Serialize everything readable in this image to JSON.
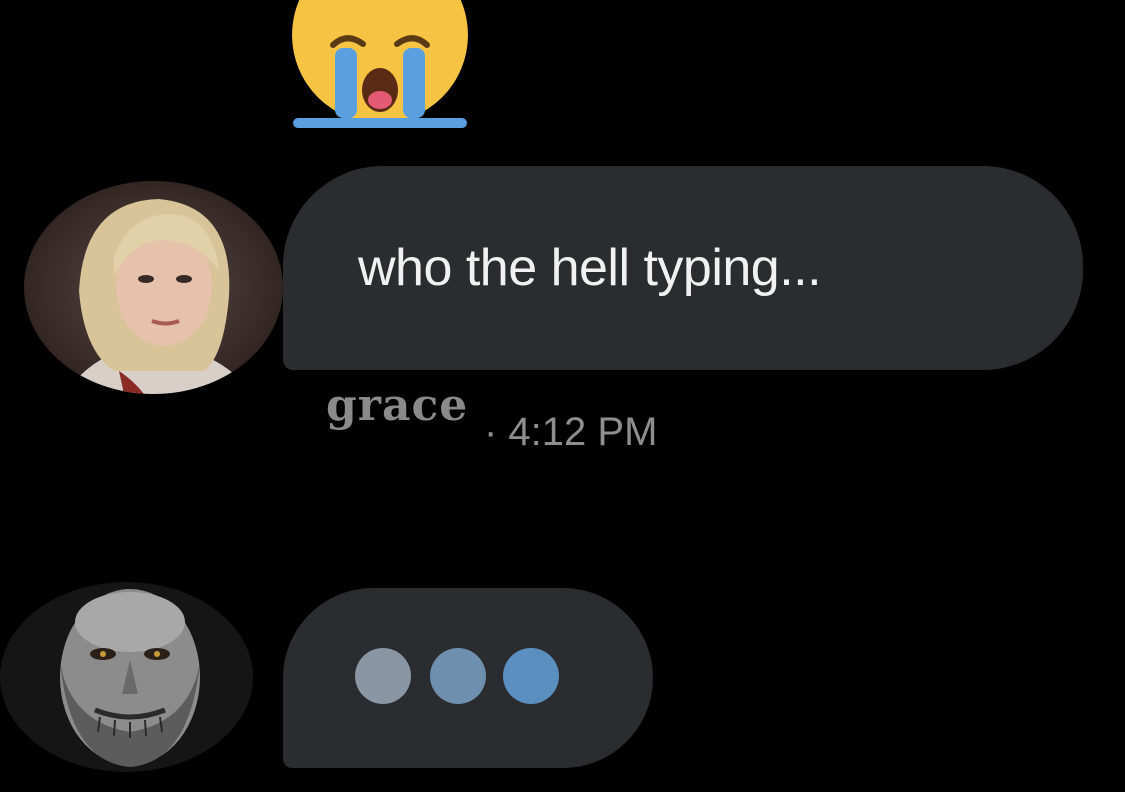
{
  "reaction": {
    "emoji_icon": "loudly-crying-face-icon"
  },
  "messages": [
    {
      "sender_avatar": "grace-avatar",
      "text": "who the hell typing...",
      "sender_name": "grace",
      "timestamp": "· 4:12 PM"
    }
  ],
  "typing_indicator": {
    "sender_avatar": "typing-user-avatar",
    "dot_colors": [
      "#8a96a3",
      "#6e8fae",
      "#5b8fbf"
    ]
  },
  "colors": {
    "background": "#000000",
    "bubble": "#2a2c2f",
    "message_text": "#f1f1f1",
    "meta_text": "#8e8e8e"
  }
}
